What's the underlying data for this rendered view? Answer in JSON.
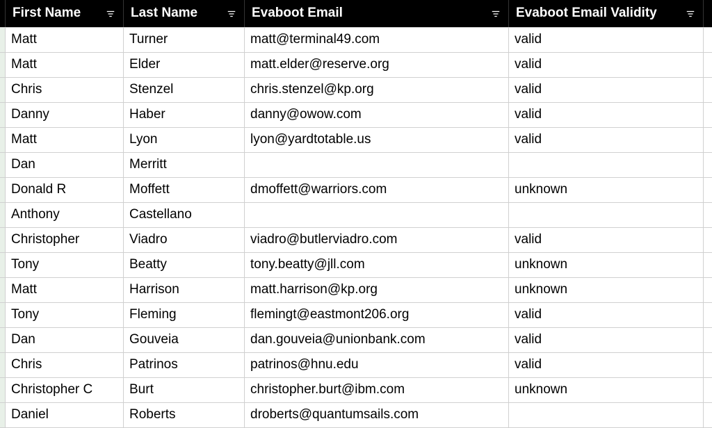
{
  "table": {
    "columns": [
      {
        "key": "first_name",
        "label": "First Name",
        "filterable": true
      },
      {
        "key": "last_name",
        "label": "Last Name",
        "filterable": true
      },
      {
        "key": "email",
        "label": "Evaboot Email",
        "filterable": true
      },
      {
        "key": "validity",
        "label": "Evaboot Email Validity",
        "filterable": true
      }
    ],
    "rows": [
      {
        "first_name": "Matt",
        "last_name": "Turner",
        "email": "matt@terminal49.com",
        "validity": "valid"
      },
      {
        "first_name": "Matt",
        "last_name": "Elder",
        "email": "matt.elder@reserve.org",
        "validity": "valid"
      },
      {
        "first_name": "Chris",
        "last_name": "Stenzel",
        "email": "chris.stenzel@kp.org",
        "validity": "valid"
      },
      {
        "first_name": "Danny",
        "last_name": "Haber",
        "email": "danny@owow.com",
        "validity": "valid"
      },
      {
        "first_name": "Matt",
        "last_name": "Lyon",
        "email": "lyon@yardtotable.us",
        "validity": "valid"
      },
      {
        "first_name": "Dan",
        "last_name": "Merritt",
        "email": "",
        "validity": ""
      },
      {
        "first_name": "Donald R",
        "last_name": "Moffett",
        "email": "dmoffett@warriors.com",
        "validity": "unknown"
      },
      {
        "first_name": "Anthony",
        "last_name": "Castellano",
        "email": "",
        "validity": ""
      },
      {
        "first_name": "Christopher",
        "last_name": "Viadro",
        "email": "viadro@butlerviadro.com",
        "validity": "valid"
      },
      {
        "first_name": "Tony",
        "last_name": "Beatty",
        "email": "tony.beatty@jll.com",
        "validity": "unknown"
      },
      {
        "first_name": "Matt",
        "last_name": "Harrison",
        "email": "matt.harrison@kp.org",
        "validity": "unknown"
      },
      {
        "first_name": "Tony",
        "last_name": "Fleming",
        "email": "flemingt@eastmont206.org",
        "validity": "valid"
      },
      {
        "first_name": "Dan",
        "last_name": "Gouveia",
        "email": "dan.gouveia@unionbank.com",
        "validity": "valid"
      },
      {
        "first_name": "Chris",
        "last_name": "Patrinos",
        "email": "patrinos@hnu.edu",
        "validity": "valid"
      },
      {
        "first_name": "Christopher C",
        "last_name": "Burt",
        "email": "christopher.burt@ibm.com",
        "validity": "unknown"
      },
      {
        "first_name": "Daniel",
        "last_name": "Roberts",
        "email": "droberts@quantumsails.com",
        "validity": ""
      }
    ]
  }
}
